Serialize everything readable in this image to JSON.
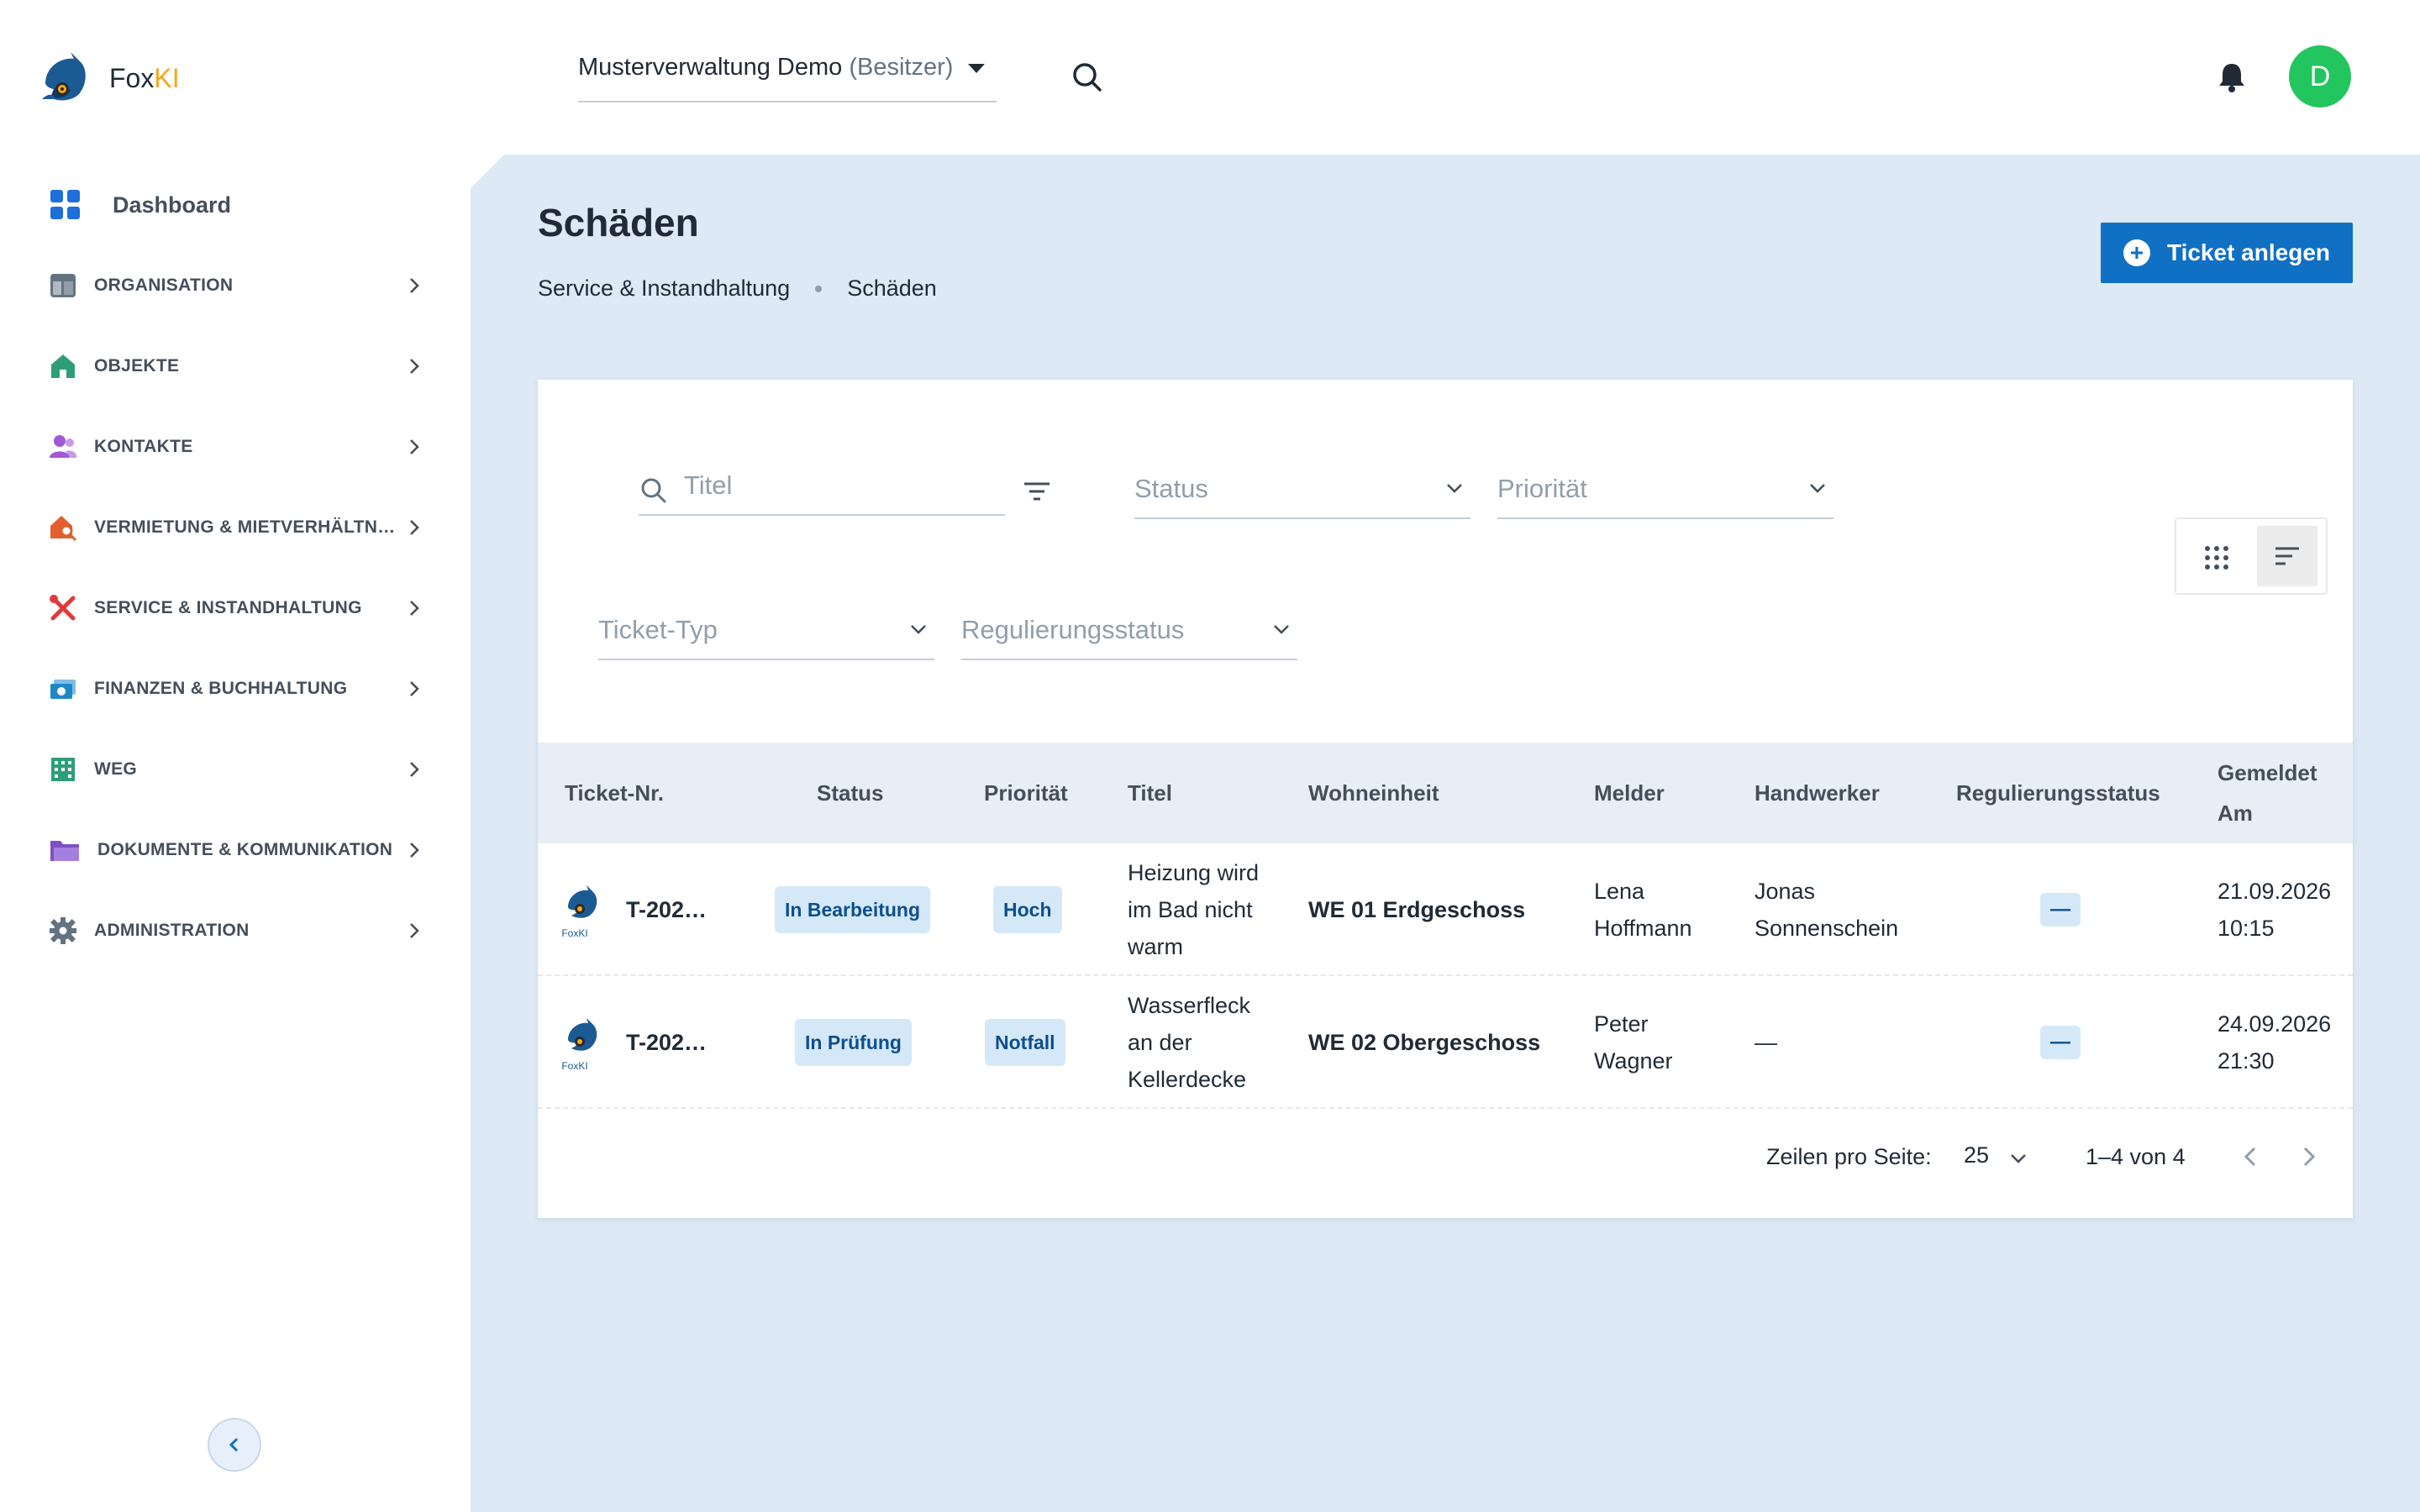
{
  "app": {
    "name_prefix": "Fox",
    "name_suffix": "KI",
    "logo_small_text": "FoxKI"
  },
  "header": {
    "org_name": "Musterverwaltung Demo",
    "org_role": "(Besitzer)",
    "avatar_letter": "D"
  },
  "sidebar": {
    "dashboard": "Dashboard",
    "items": [
      {
        "label": "ORGANISATION",
        "icon": "layout-icon",
        "color": "#637381"
      },
      {
        "label": "OBJEKTE",
        "icon": "home-icon",
        "color": "#2e9e77"
      },
      {
        "label": "KONTAKTE",
        "icon": "users-icon",
        "color": "#a05ad6"
      },
      {
        "label": "VERMIETUNG & MIETVERHÄLTN…",
        "icon": "house-search-icon",
        "color": "#e0612f"
      },
      {
        "label": "SERVICE & INSTANDHALTUNG",
        "icon": "tools-icon",
        "color": "#e03b3b"
      },
      {
        "label": "FINANZEN & BUCHHALTUNG",
        "icon": "money-icon",
        "color": "#1e88c7"
      },
      {
        "label": "WEG",
        "icon": "building-icon",
        "color": "#2e9e77"
      },
      {
        "label": "DOKUMENTE & KOMMUNIKATION",
        "icon": "folder-icon",
        "color": "#7e4fc4"
      },
      {
        "label": "ADMINISTRATION",
        "icon": "gear-icon",
        "color": "#637381"
      }
    ]
  },
  "page": {
    "title": "Schäden",
    "breadcrumb": [
      "Service & Instandhaltung",
      "Schäden"
    ],
    "create_button": "Ticket anlegen"
  },
  "filters": {
    "search_placeholder": "Titel",
    "status": "Status",
    "priority": "Priorität",
    "ticket_type": "Ticket-Typ",
    "regulation_status": "Regulierungsstatus"
  },
  "table": {
    "columns": [
      "Ticket-Nr.",
      "Status",
      "Priorität",
      "Titel",
      "Wohneinheit",
      "Melder",
      "Handwerker",
      "Regulierungsstatus",
      "Gemeldet Am"
    ],
    "rows": [
      {
        "ticket": "T-202…",
        "status": "In Bearbeitung",
        "priority": "Hoch",
        "title": "Heizung wird im Bad nicht warm",
        "unit": "WE 01 Erdgeschoss",
        "reporter": "Lena Hoffmann",
        "craftsman": "Jonas Sonnenschein",
        "regulation": "—",
        "date": "21.09.2026 10:15"
      },
      {
        "ticket": "T-202…",
        "status": "In Prüfung",
        "priority": "Notfall",
        "title": "Wasserfleck an der Kellerdecke",
        "unit": "WE 02 Obergeschoss",
        "reporter": "Peter Wagner",
        "craftsman": "—",
        "regulation": "—",
        "date": "24.09.2026 21:30"
      }
    ]
  },
  "pagination": {
    "rows_per_page_label": "Zeilen pro Seite:",
    "rows_per_page": "25",
    "range": "1–4 von 4"
  },
  "colors": {
    "primary": "#1070c4",
    "avatar": "#22c55e",
    "main_bg": "#dde9f5"
  }
}
